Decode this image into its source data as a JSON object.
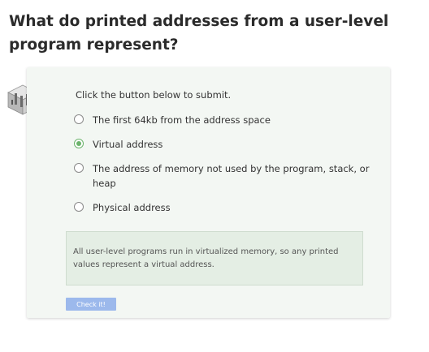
{
  "question": {
    "title": "What do printed addresses from a user-level program represent?"
  },
  "quiz": {
    "icon": "quiz-building-icon",
    "instruction": "Click the button below to submit.",
    "options": [
      {
        "label": "The first 64kb from the address space",
        "selected": false
      },
      {
        "label": "Virtual address",
        "selected": true
      },
      {
        "label": "The address of memory not used by the program, stack, or heap",
        "selected": false
      },
      {
        "label": "Physical address",
        "selected": false
      }
    ],
    "feedback": "All user-level programs run in virtualized memory, so any printed values represent a virtual address.",
    "check_button_label": "Check it!"
  },
  "colors": {
    "card_background": "#f3f7f3",
    "selected_radio": "#6bb36b",
    "feedback_background": "#e4eee4",
    "button_background": "#9cb9ec"
  }
}
